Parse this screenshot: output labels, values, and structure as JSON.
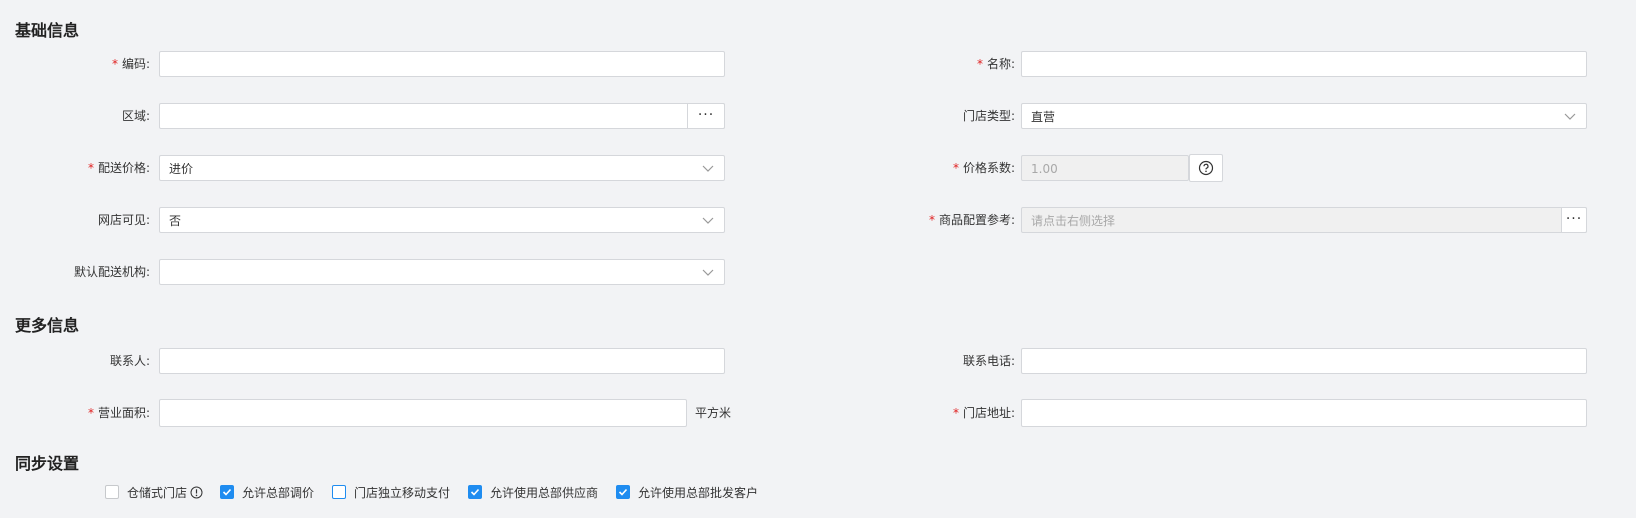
{
  "sections": {
    "basic": "基础信息",
    "more": "更多信息",
    "sync": "同步设置"
  },
  "basic": {
    "code": {
      "label": "编码:",
      "value": ""
    },
    "name": {
      "label": "名称:",
      "value": ""
    },
    "region": {
      "label": "区域:",
      "value": "",
      "button": "···"
    },
    "store_type": {
      "label": "门店类型:",
      "value": "直营"
    },
    "delivery_price": {
      "label": "配送价格:",
      "value": "进价"
    },
    "price_factor": {
      "label": "价格系数:",
      "value": "1.00"
    },
    "online_visible": {
      "label": "网店可见:",
      "value": "否"
    },
    "goods_config_ref": {
      "label": "商品配置参考:",
      "placeholder": "请点击右侧选择",
      "button": "···"
    },
    "default_delivery_org": {
      "label": "默认配送机构:",
      "value": ""
    }
  },
  "more": {
    "contact": {
      "label": "联系人:",
      "value": ""
    },
    "phone": {
      "label": "联系电话:",
      "value": ""
    },
    "area": {
      "label": "营业面积:",
      "value": "",
      "unit": "平方米"
    },
    "address": {
      "label": "门店地址:",
      "value": ""
    }
  },
  "sync": {
    "options": [
      {
        "label": "仓储式门店",
        "checked": false
      },
      {
        "label": "允许总部调价",
        "checked": true
      },
      {
        "label": "门店独立移动支付",
        "checked": false
      },
      {
        "label": "允许使用总部供应商",
        "checked": true
      },
      {
        "label": "允许使用总部批发客户",
        "checked": true
      }
    ]
  },
  "colors": {
    "accent": "#1f8cf0",
    "required": "#e02020"
  }
}
